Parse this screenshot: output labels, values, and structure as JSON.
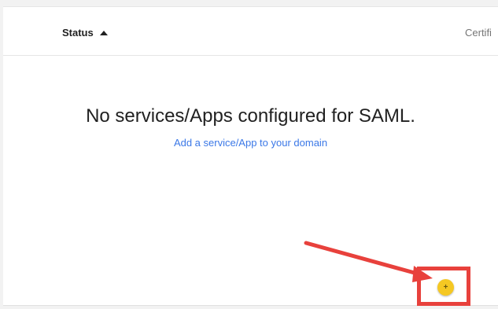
{
  "table": {
    "columns": [
      {
        "label": "Status",
        "sorted": "ascending"
      },
      {
        "label": "Certifi"
      }
    ]
  },
  "empty_state": {
    "message": "No services/Apps configured for SAML.",
    "link_label": "Add a service/App to your domain"
  },
  "fab": {
    "icon": "plus-icon",
    "glyph": "+",
    "color": "#f5c823"
  },
  "annotation": {
    "color": "#e8413c"
  }
}
